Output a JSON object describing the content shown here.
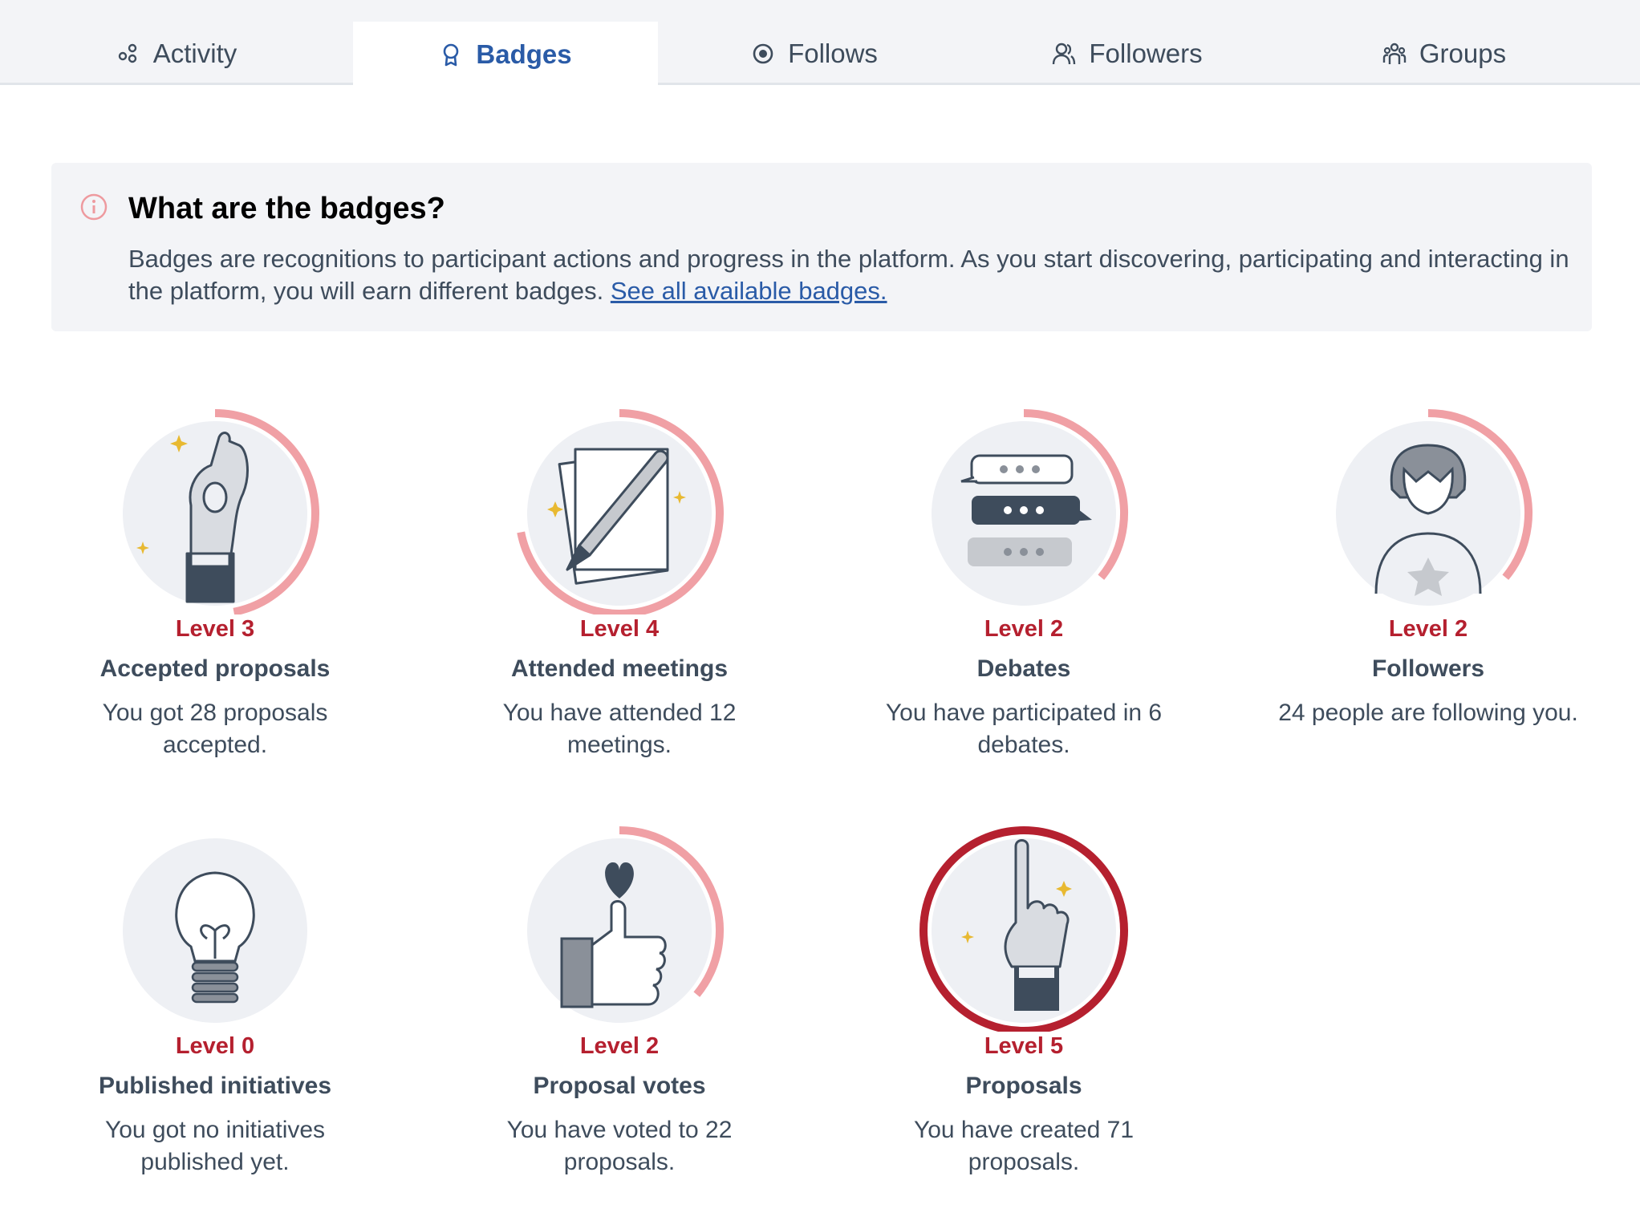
{
  "tabs": [
    {
      "label": "Activity",
      "icon": "activity-icon",
      "active": false
    },
    {
      "label": "Badges",
      "icon": "badge-icon",
      "active": true
    },
    {
      "label": "Follows",
      "icon": "eye-icon",
      "active": false
    },
    {
      "label": "Followers",
      "icon": "users-icon",
      "active": false
    },
    {
      "label": "Groups",
      "icon": "group-icon",
      "active": false
    }
  ],
  "info": {
    "title": "What are the badges?",
    "text": "Badges are recognitions to participant actions and progress in the platform. As you start discovering, participating and interacting in the platform, you will earn different badges. ",
    "link": "See all available badges."
  },
  "colors": {
    "accent": "#2a5ba7",
    "level_text": "#b5202f",
    "progress_light": "#f0a0a5",
    "progress_full": "#b5202f",
    "badge_bg": "#eef0f4"
  },
  "badges": [
    {
      "level": "Level 3",
      "name": "Accepted proposals",
      "desc": "You got 28 proposals accepted.",
      "icon": "ok-hand-icon",
      "progress": 0.47
    },
    {
      "level": "Level 4",
      "name": "Attended meetings",
      "desc": "You have attended 12 meetings.",
      "icon": "pencil-notes-icon",
      "progress": 0.72
    },
    {
      "level": "Level 2",
      "name": "Debates",
      "desc": "You have participated in 6 debates.",
      "icon": "speech-bubbles-icon",
      "progress": 0.36
    },
    {
      "level": "Level 2",
      "name": "Followers",
      "desc": "24 people are following you.",
      "icon": "person-icon",
      "progress": 0.36
    },
    {
      "level": "Level 0",
      "name": "Published initiatives",
      "desc": "You got no initiatives published yet.",
      "icon": "lightbulb-icon",
      "progress": 0
    },
    {
      "level": "Level 2",
      "name": "Proposal votes",
      "desc": "You have voted to 22 proposals.",
      "icon": "thumbs-up-icon",
      "progress": 0.36
    },
    {
      "level": "Level 5",
      "name": "Proposals",
      "desc": "You have created 71 proposals.",
      "icon": "raised-finger-icon",
      "progress": 1
    }
  ]
}
